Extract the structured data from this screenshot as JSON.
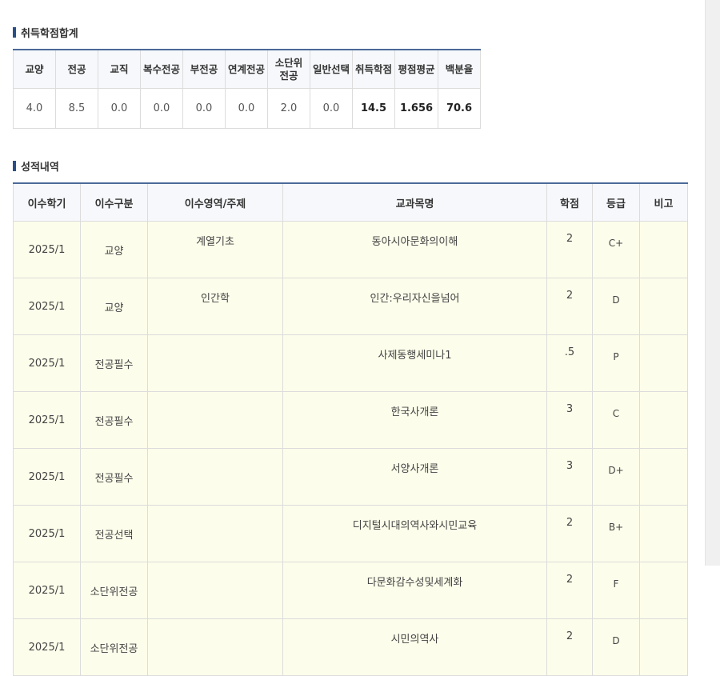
{
  "summary": {
    "title": "취득학점합계",
    "headers": [
      "교양",
      "전공",
      "교직",
      "복수전공",
      "부전공",
      "연계전공",
      "소단위\n전공",
      "일반선택",
      "취득학점",
      "평점평균",
      "백분율"
    ],
    "values": [
      "4.0",
      "8.5",
      "0.0",
      "0.0",
      "0.0",
      "0.0",
      "2.0",
      "0.0",
      "14.5",
      "1.656",
      "70.6"
    ]
  },
  "grades": {
    "title": "성적내역",
    "headers": [
      "이수학기",
      "이수구분",
      "이수영역/주제",
      "교과목명",
      "학점",
      "등급",
      "비고"
    ],
    "rows": [
      {
        "term": "2025/1",
        "type": "교양",
        "area": "계열기초",
        "course": "동아시아문화의이해",
        "credit": "2",
        "grade": "C+",
        "note": ""
      },
      {
        "term": "2025/1",
        "type": "교양",
        "area": "인간학",
        "course": "인간:우리자신을넘어",
        "credit": "2",
        "grade": "D",
        "note": ""
      },
      {
        "term": "2025/1",
        "type": "전공필수",
        "area": "",
        "course": "사제동행세미나1",
        "credit": ".5",
        "grade": "P",
        "note": ""
      },
      {
        "term": "2025/1",
        "type": "전공필수",
        "area": "",
        "course": "한국사개론",
        "credit": "3",
        "grade": "C",
        "note": ""
      },
      {
        "term": "2025/1",
        "type": "전공필수",
        "area": "",
        "course": "서양사개론",
        "credit": "3",
        "grade": "D+",
        "note": ""
      },
      {
        "term": "2025/1",
        "type": "전공선택",
        "area": "",
        "course": "디지털시대의역사와시민교육",
        "credit": "2",
        "grade": "B+",
        "note": ""
      },
      {
        "term": "2025/1",
        "type": "소단위전공",
        "area": "",
        "course": "다문화감수성및세계화",
        "credit": "2",
        "grade": "F",
        "note": ""
      },
      {
        "term": "2025/1",
        "type": "소단위전공",
        "area": "",
        "course": "시민의역사",
        "credit": "2",
        "grade": "D",
        "note": ""
      }
    ]
  }
}
